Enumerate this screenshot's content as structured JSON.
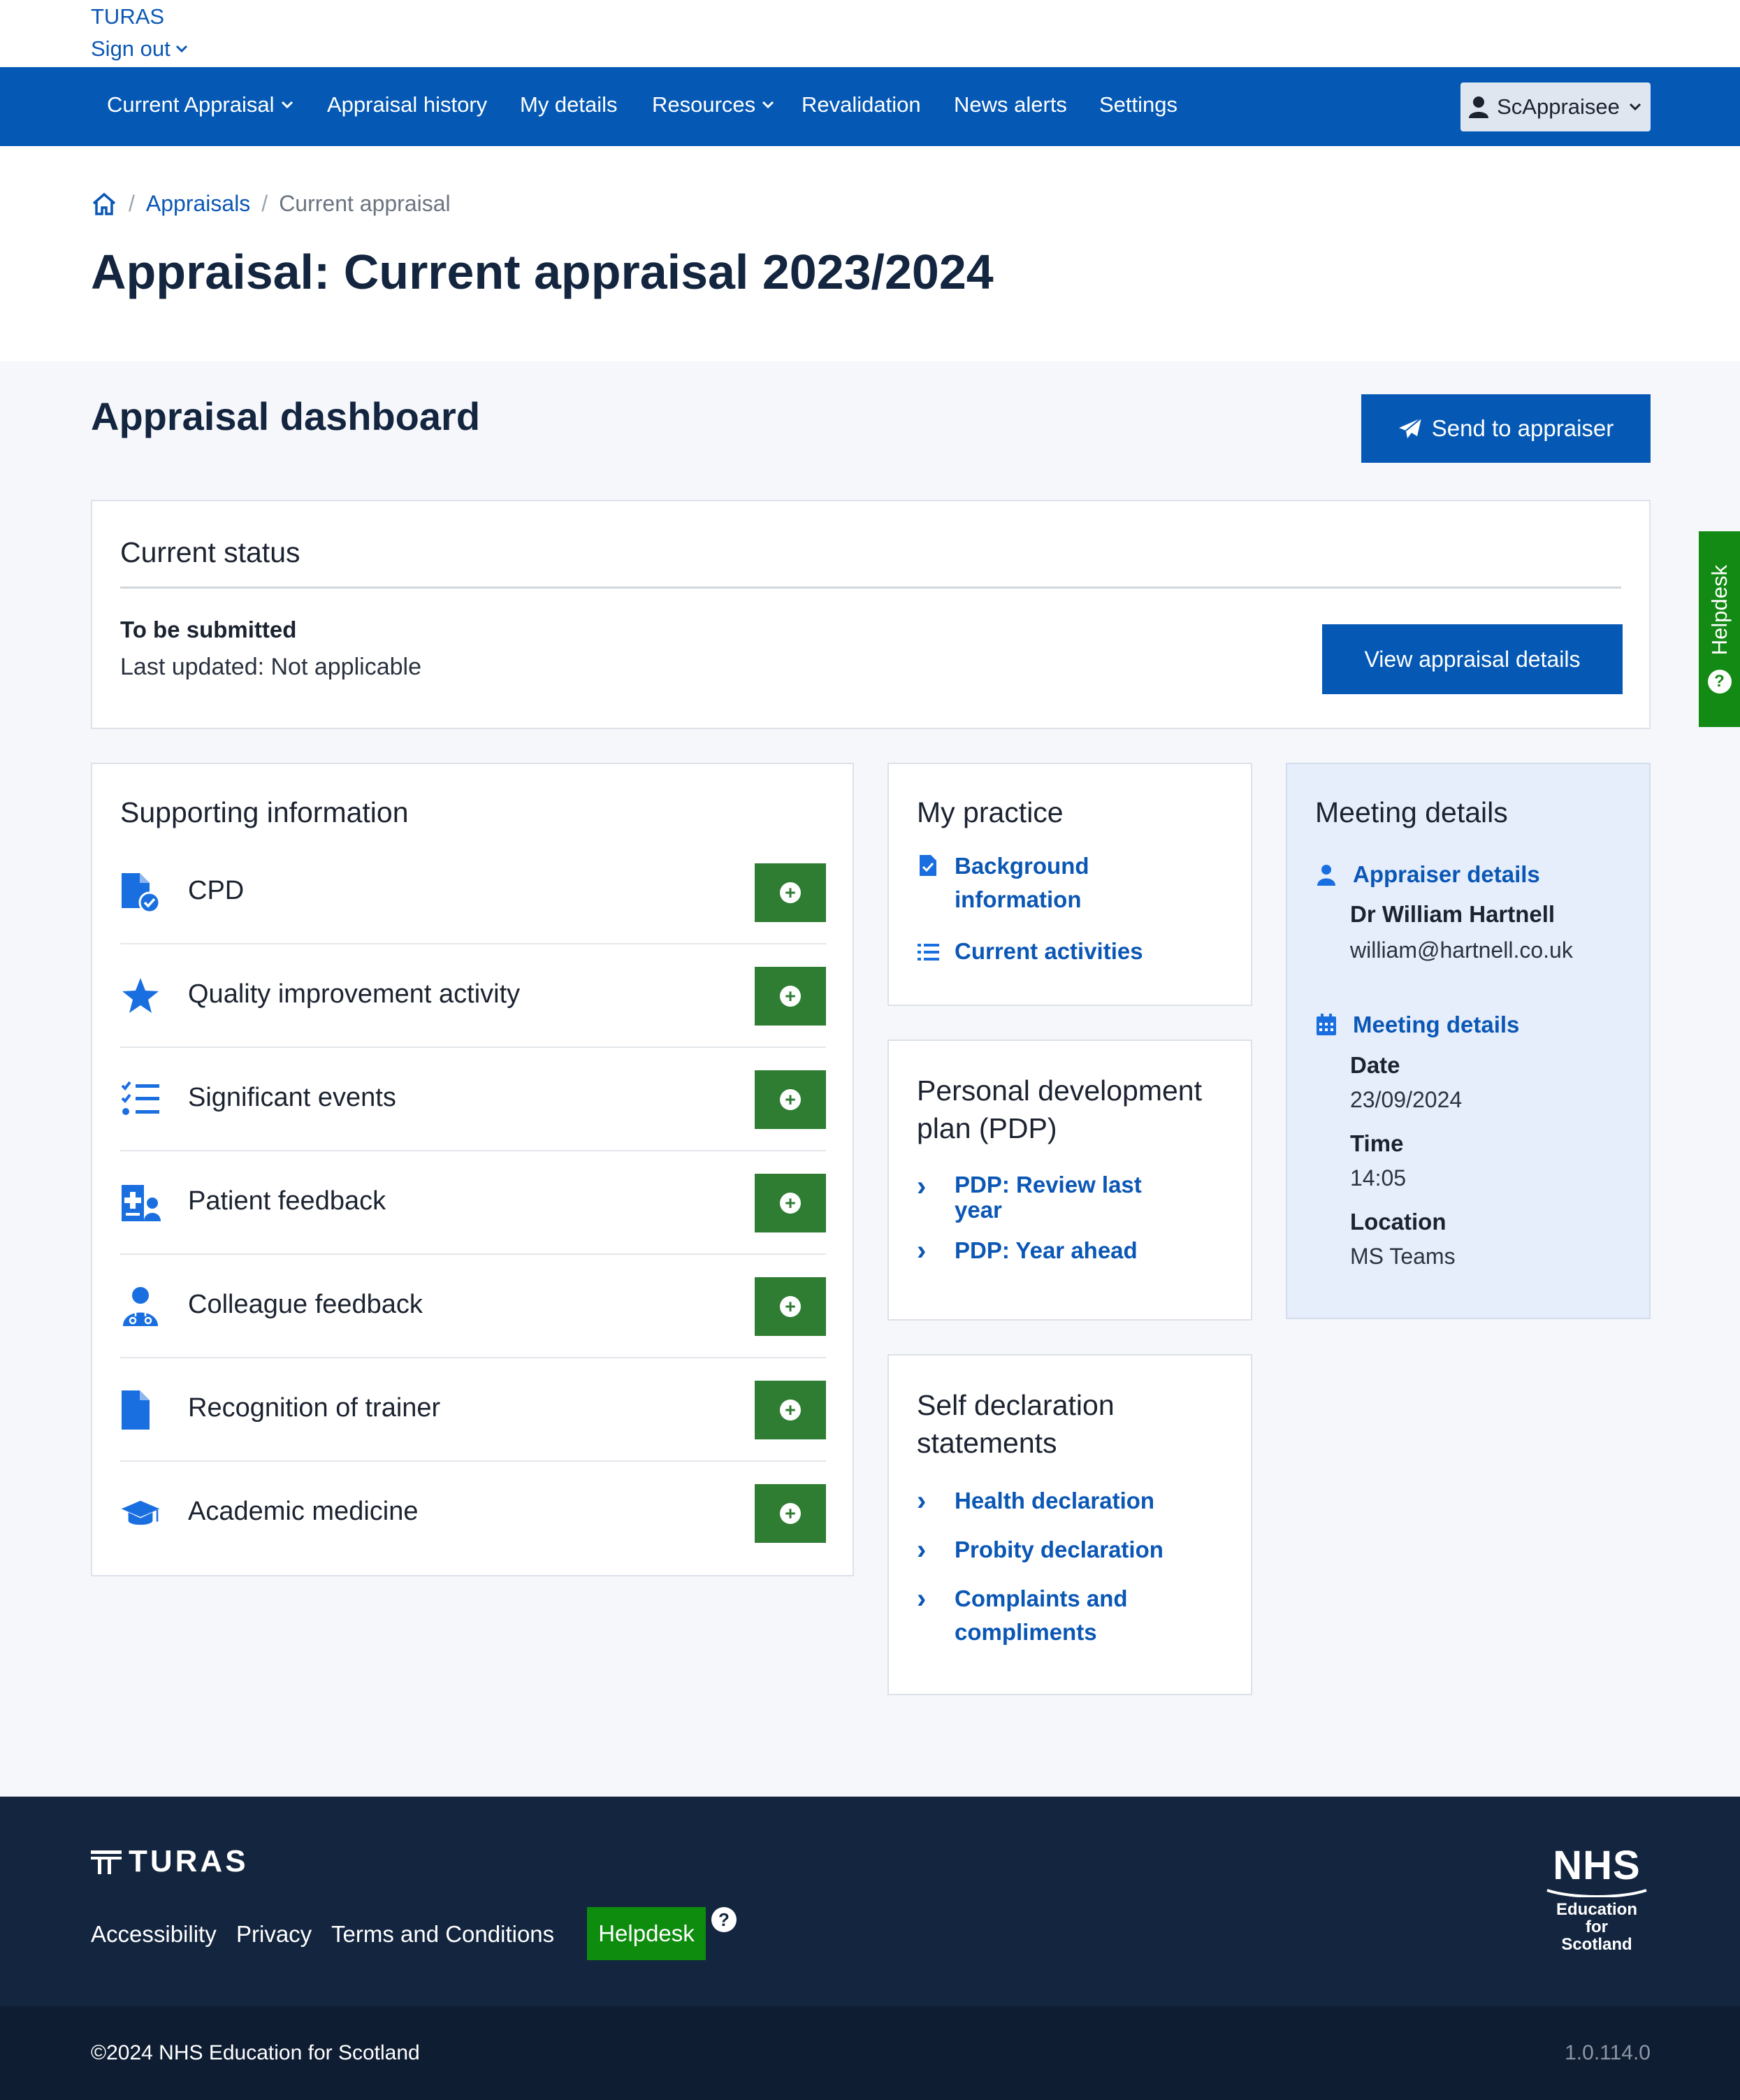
{
  "topbar": {
    "brand": "TURAS",
    "sign_out": "Sign out"
  },
  "nav": {
    "items": [
      "Current Appraisal",
      "Appraisal history",
      "My details",
      "Resources",
      "Revalidation",
      "News alerts",
      "Settings"
    ],
    "user": "ScAppraisee"
  },
  "breadcrumb": {
    "appraisals": "Appraisals",
    "current": "Current appraisal"
  },
  "page_title": "Appraisal: Current appraisal 2023/2024",
  "dashboard": {
    "title": "Appraisal dashboard",
    "send_button": "Send to appraiser"
  },
  "status": {
    "heading": "Current status",
    "state": "To be submitted",
    "last_updated": "Last updated: Not applicable",
    "view_button": "View appraisal details"
  },
  "supporting_info": {
    "heading": "Supporting information",
    "items": [
      {
        "label": "CPD",
        "icon": "file-check-icon"
      },
      {
        "label": "Quality improvement activity",
        "icon": "star-icon"
      },
      {
        "label": "Significant events",
        "icon": "checklist-icon"
      },
      {
        "label": "Patient feedback",
        "icon": "patient-feedback-icon"
      },
      {
        "label": "Colleague feedback",
        "icon": "doctor-icon"
      },
      {
        "label": "Recognition of trainer",
        "icon": "file-icon"
      },
      {
        "label": "Academic medicine",
        "icon": "graduation-cap-icon"
      }
    ]
  },
  "my_practice": {
    "heading": "My practice",
    "background_line1": "Background",
    "background_line2": "information",
    "current_activities": "Current activities"
  },
  "pdp": {
    "heading_line1": "Personal development",
    "heading_line2": "plan (PDP)",
    "review_line1": "PDP: Review last",
    "review_line2": "year",
    "year_ahead": "PDP: Year ahead"
  },
  "self_declaration": {
    "heading_line1": "Self declaration",
    "heading_line2": "statements",
    "health": "Health declaration",
    "probity": "Probity declaration",
    "complaints_line1": "Complaints and",
    "complaints_line2": "compliments"
  },
  "meeting": {
    "heading": "Meeting details",
    "appraiser_link": "Appraiser details",
    "appraiser_name": "Dr William Hartnell",
    "appraiser_email": "william@hartnell.co.uk",
    "meeting_link": "Meeting details",
    "date_label": "Date",
    "date_value": "23/09/2024",
    "time_label": "Time",
    "time_value": "14:05",
    "location_label": "Location",
    "location_value": "MS Teams"
  },
  "helpdesk_tab": "Helpdesk",
  "footer": {
    "logo": "TURAS",
    "links": [
      "Accessibility",
      "Privacy",
      "Terms and Conditions"
    ],
    "helpdesk": "Helpdesk",
    "nhs_big": "NHS",
    "nhs_line1": "Education",
    "nhs_line2": "for",
    "nhs_line3": "Scotland"
  },
  "bottom": {
    "copyright": "©2024 NHS Education for Scotland",
    "version": "1.0.114.0"
  },
  "colors": {
    "primary": "#0559b5",
    "add_green": "#2e7d32",
    "helpdesk_green": "#138a13",
    "footer": "#13253f",
    "meeting_bg": "#e6eefb"
  }
}
